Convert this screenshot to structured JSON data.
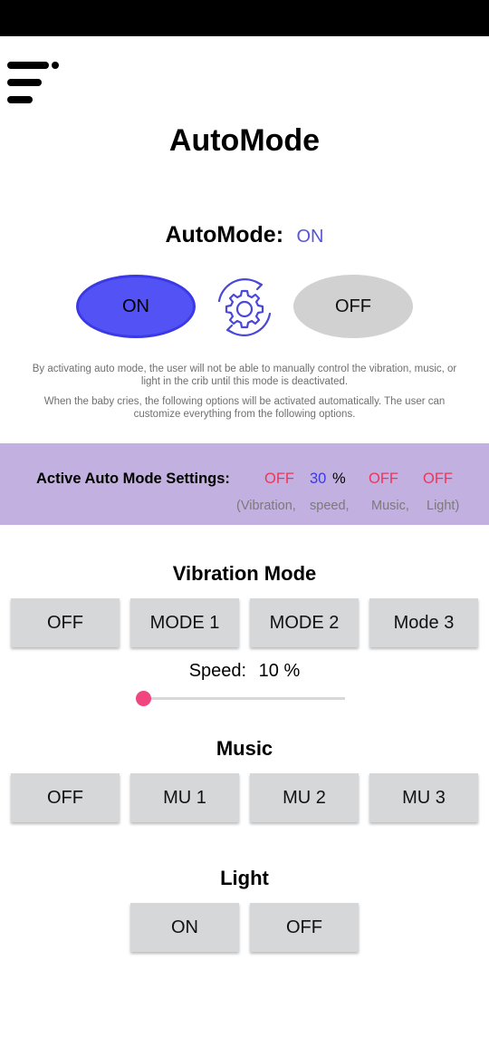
{
  "header": {
    "title": "AutoMode"
  },
  "automode": {
    "label": "AutoMode:",
    "value": "ON",
    "on_button": "ON",
    "off_button": "OFF",
    "description_1": "By activating auto mode, the user will not be able to manually control the vibration, music, or light in the crib until this mode is deactivated.",
    "description_2": "When the baby cries, the following options will be activated automatically. The user can customize everything from the following options."
  },
  "active_settings": {
    "title": "Active Auto Mode Settings:",
    "vibration": "OFF",
    "speed": "30",
    "percent": "%",
    "music": "OFF",
    "light": "OFF",
    "label_vibration": "(Vibration,",
    "label_speed": "speed,",
    "label_music": "Music,",
    "label_light": "Light)"
  },
  "vibration": {
    "title": "Vibration Mode",
    "buttons": [
      "OFF",
      "MODE 1",
      "MODE 2",
      "Mode 3"
    ],
    "speed_label": "Speed:",
    "speed_value": "10 %",
    "speed_slider": 0.0
  },
  "music": {
    "title": "Music",
    "buttons": [
      "OFF",
      "MU 1",
      "MU 2",
      "MU 3"
    ]
  },
  "light": {
    "title": "Light",
    "buttons": [
      "ON",
      "OFF"
    ]
  },
  "colors": {
    "accent_blue": "#5352f5",
    "band_purple": "#c2b0e0",
    "status_red": "#f0345a",
    "slider_pink": "#f0457e",
    "button_gray": "#d6d7d8"
  },
  "icons": {
    "menu": "menu-icon",
    "gear": "gear-sync-icon"
  }
}
